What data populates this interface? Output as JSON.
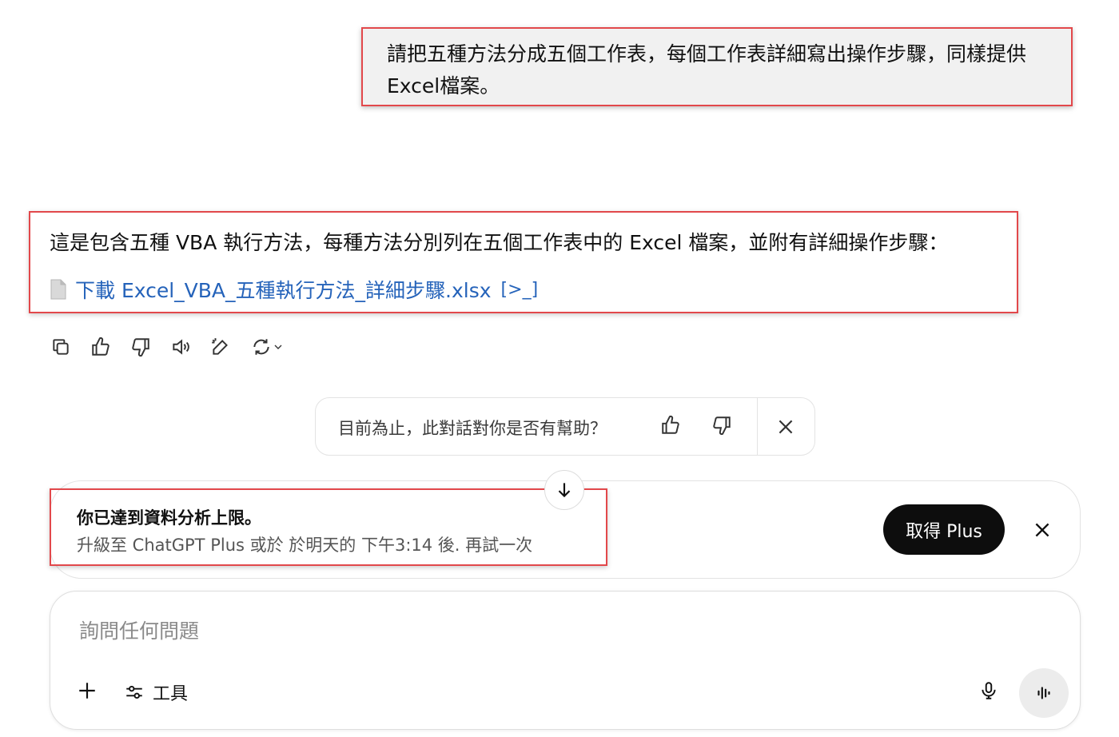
{
  "user_message": {
    "text": "請把五種方法分成五個工作表，每個工作表詳細寫出操作步驟，同樣提供Excel檔案。"
  },
  "assistant_reply": {
    "text": "這是包含五種 VBA 執行方法，每種方法分別列在五個工作表中的 Excel 檔案，並附有詳細操作步驟：",
    "file_link": "下載 Excel_VBA_五種執行方法_詳細步驟.xlsx",
    "code_icon_glyph": "[>_]"
  },
  "action_icons": [
    "copy-icon",
    "thumbs-up-icon",
    "thumbs-down-icon",
    "read-aloud-icon",
    "edit-icon",
    "regenerate-icon",
    "chevron-down-icon"
  ],
  "feedback": {
    "question": "目前為止，此對話對你是否有幫助？"
  },
  "limit_banner": {
    "title": "你已達到資料分析上限。",
    "subtitle": "升級至 ChatGPT Plus 或於 於明天的 下午3:14 後. 再試一次",
    "button_label": "取得 Plus"
  },
  "composer": {
    "placeholder": "詢問任何問題",
    "tools_label": "工具"
  },
  "colors": {
    "highlight_border": "#e2484b",
    "link": "#2563ba",
    "button_dark": "#0d0d0d"
  }
}
